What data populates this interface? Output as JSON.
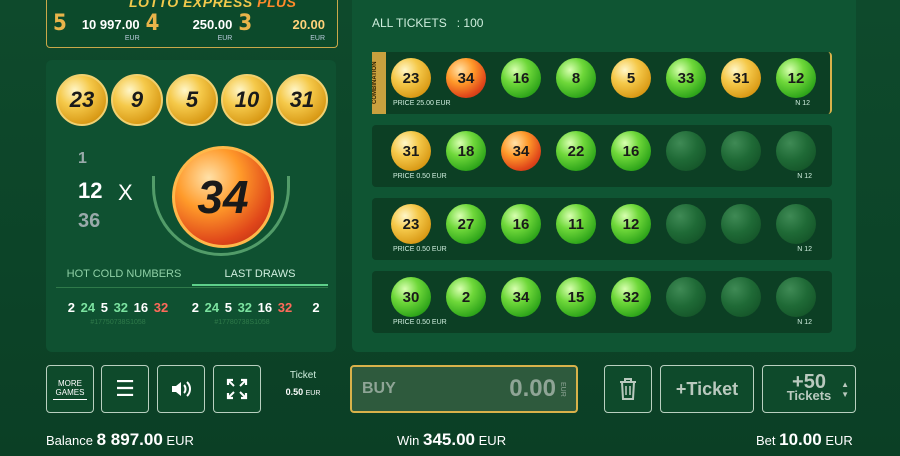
{
  "header": {
    "logo": "LOTTO EXPRESS",
    "logo_plus": "PLUS",
    "jackpots": [
      {
        "n": "5",
        "value": "10 997.00",
        "currency": "EUR"
      },
      {
        "n": "4",
        "value": "250.00",
        "currency": "EUR"
      },
      {
        "n": "3",
        "value": "20.00",
        "currency": "EUR"
      }
    ]
  },
  "draw": {
    "drawn_balls": [
      "23",
      "9",
      "5",
      "10",
      "31"
    ],
    "current_ball": "34",
    "counter_prev": "1",
    "counter_current": "12",
    "counter_next": "36",
    "multiply_sign": "X",
    "tabs": [
      "HOT COLD NUMBERS",
      "LAST DRAWS"
    ],
    "last_draws": [
      {
        "numbers": [
          "2",
          "24",
          "5",
          "32",
          "16",
          "32"
        ],
        "id": "#17750738S1058"
      },
      {
        "numbers": [
          "2",
          "24",
          "5",
          "32",
          "16",
          "32"
        ],
        "id": "#17780738S1058"
      },
      {
        "numbers": [
          "2"
        ],
        "id": ""
      }
    ]
  },
  "tickets_header": {
    "label": "ALL TICKETS",
    "separator": ":",
    "count": "100"
  },
  "tickets": [
    {
      "combo_label": "COMBINATION",
      "balls": [
        "23",
        "34",
        "16",
        "8",
        "5",
        "33",
        "31",
        "12"
      ],
      "colors": [
        "gold",
        "red",
        "green",
        "green",
        "gold",
        "green",
        "gold",
        "green"
      ],
      "price": "PRICE 25.00 EUR",
      "n": "N 12"
    },
    {
      "balls": [
        "31",
        "18",
        "34",
        "22",
        "16",
        "",
        "",
        ""
      ],
      "colors": [
        "gold",
        "green",
        "red",
        "green",
        "green",
        "empty",
        "empty",
        "empty"
      ],
      "price": "PRICE 0.50 EUR",
      "n": "N 12"
    },
    {
      "balls": [
        "23",
        "27",
        "16",
        "11",
        "12",
        "",
        "",
        ""
      ],
      "colors": [
        "gold",
        "green",
        "green",
        "green",
        "green",
        "empty",
        "empty",
        "empty"
      ],
      "price": "PRICE 0.50 EUR",
      "n": "N 12"
    },
    {
      "balls": [
        "30",
        "2",
        "34",
        "15",
        "32",
        "",
        "",
        ""
      ],
      "colors": [
        "green",
        "green",
        "green",
        "green",
        "green",
        "empty",
        "empty",
        "empty"
      ],
      "price": "PRICE 0.50 EUR",
      "n": "N 12"
    }
  ],
  "controls": {
    "more_games": "MORE GAMES",
    "ticket_label": "Ticket",
    "ticket_value": "0.50",
    "ticket_currency": "EUR",
    "buy_label": "BUY",
    "buy_amount": "0.00",
    "buy_currency": "EUR",
    "add_ticket": "+Ticket",
    "plus50": "+50",
    "plus50_sub": "Tickets"
  },
  "status": {
    "balance_label": "Balance",
    "balance_value": "8 897.00",
    "balance_currency": "EUR",
    "win_label": "Win",
    "win_value": "345.00",
    "win_currency": "EUR",
    "bet_label": "Bet",
    "bet_value": "10.00",
    "bet_currency": "EUR"
  }
}
